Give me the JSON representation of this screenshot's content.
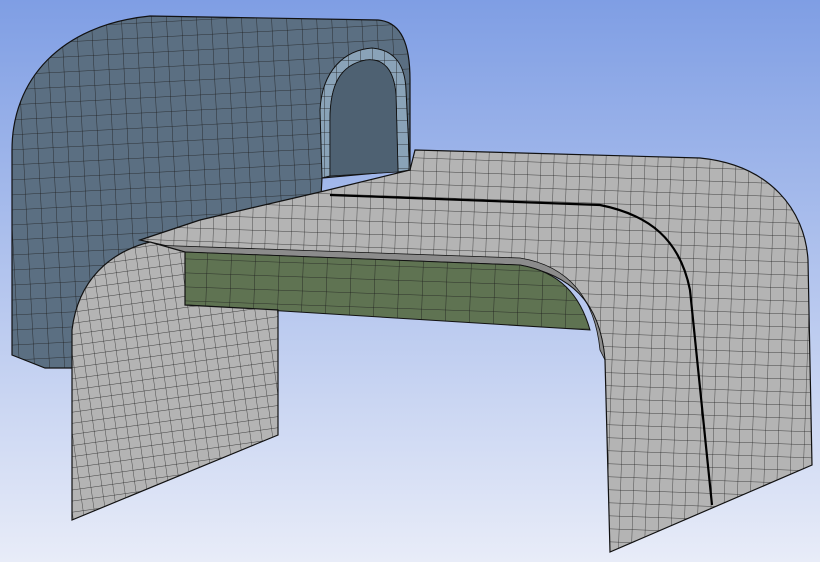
{
  "viewport": {
    "background_top": "#7f9ee4",
    "background_bottom": "#e8ecf8",
    "colors": {
      "back_body": "#5b6f82",
      "back_body_inner": "#8aa3b8",
      "plate": "#b4b4b4",
      "plate_side": "#8c8c8c",
      "underside": "#5f7352",
      "mesh_line": "#1c1c1c"
    }
  }
}
